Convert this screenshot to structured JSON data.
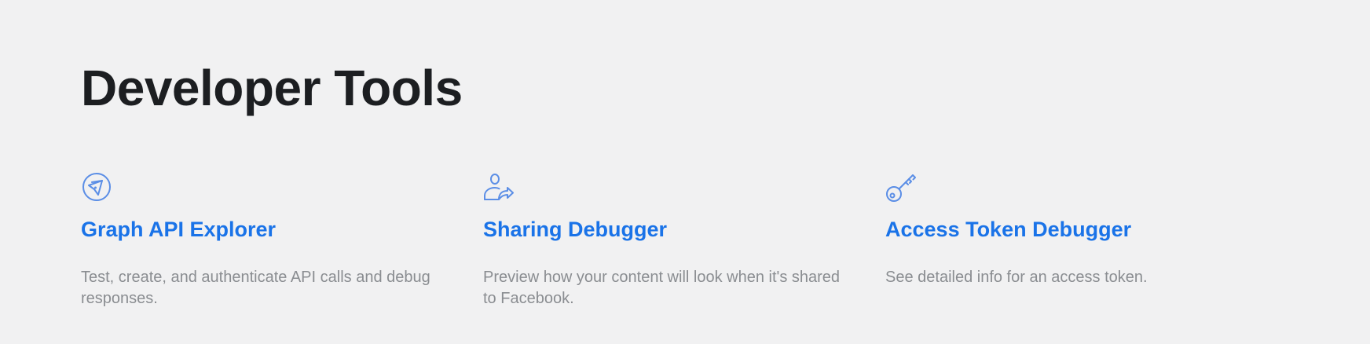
{
  "page": {
    "title": "Developer Tools"
  },
  "colors": {
    "background": "#f1f1f2",
    "title": "#1c1e21",
    "link": "#1a73e8",
    "icon": "#5b8ee6",
    "description": "#8a8d91"
  },
  "tools": [
    {
      "icon": "compass-icon",
      "title": "Graph API Explorer",
      "description": "Test, create, and authenticate API calls and debug responses."
    },
    {
      "icon": "user-share-icon",
      "title": "Sharing Debugger",
      "description": "Preview how your content will look when it's shared to Facebook."
    },
    {
      "icon": "key-icon",
      "title": "Access Token Debugger",
      "description": "See detailed info for an access token."
    }
  ]
}
